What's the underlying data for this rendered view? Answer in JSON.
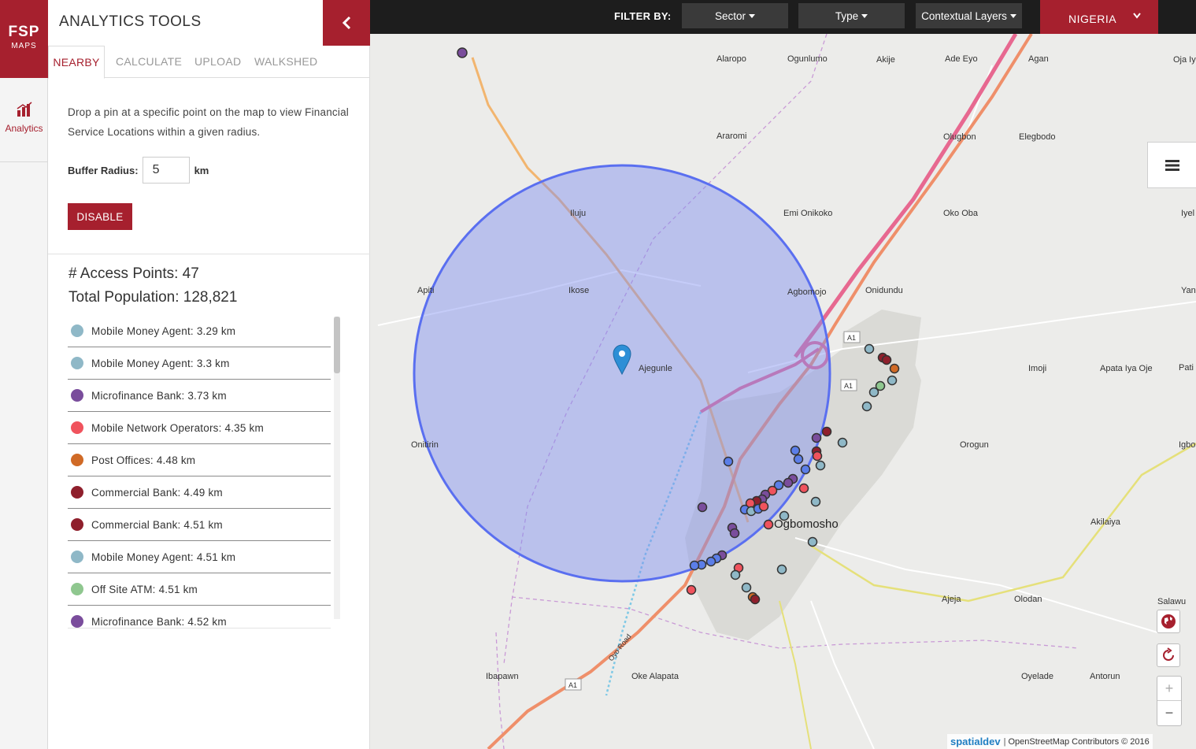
{
  "app": {
    "logo_line1": "FSP",
    "logo_line2": "MAPS",
    "rail_analytics_label": "Analytics",
    "brand_color": "#a6202e"
  },
  "panel": {
    "title": "ANALYTICS TOOLS",
    "collapse_icon": "chevron-left-icon",
    "tabs": [
      {
        "label": "NEARBY",
        "active": true
      },
      {
        "label": "CALCULATE",
        "active": false
      },
      {
        "label": "UPLOAD",
        "active": false
      },
      {
        "label": "WALKSHED",
        "active": false
      }
    ],
    "description": "Drop a pin at a specific point on the map to view Financial Service Locations within a given radius.",
    "buffer_label": "Buffer Radius:",
    "buffer_value": "5",
    "buffer_unit": "km",
    "disable_label": "DISABLE",
    "access_points": "# Access Points: 47",
    "total_population": "Total Population: 128,821",
    "results": [
      {
        "label": "Mobile Money Agent: 3.29 km",
        "color": "#8fb8c7"
      },
      {
        "label": "Mobile Money Agent: 3.3 km",
        "color": "#8fb8c7"
      },
      {
        "label": "Microfinance Bank: 3.73 km",
        "color": "#7a4d9c"
      },
      {
        "label": "Mobile Network Operators: 4.35 km",
        "color": "#f0535d"
      },
      {
        "label": "Post Offices: 4.48 km",
        "color": "#d06a26"
      },
      {
        "label": "Commercial Bank: 4.49 km",
        "color": "#8f1f2c"
      },
      {
        "label": "Commercial Bank: 4.51 km",
        "color": "#8f1f2c"
      },
      {
        "label": "Mobile Money Agent: 4.51 km",
        "color": "#8fb8c7"
      },
      {
        "label": "Off Site ATM: 4.51 km",
        "color": "#8fc78f"
      },
      {
        "label": "Microfinance Bank: 4.52 km",
        "color": "#7a4d9c"
      }
    ]
  },
  "topbar": {
    "filter_label": "FILTER BY:",
    "sector": "Sector",
    "type": "Type",
    "contextual_layers": "Contextual Layers",
    "country": "NIGERIA"
  },
  "map": {
    "places": [
      "Alaropo",
      "Ogunlumo",
      "Akije",
      "Ade Eyo",
      "Agan",
      "Oja Iy",
      "Araromi",
      "Olugbon",
      "Elegbodo",
      "Iluju",
      "Emi Onikoko",
      "Oko Oba",
      "Iyel",
      "Apiti",
      "Ikose",
      "Agbomojo",
      "Onidundu",
      "Yan",
      "Ajegunle",
      "Imoji",
      "Apata Iya Oje",
      "Pati",
      "Onitirin",
      "Orogun",
      "Igbo",
      "Akilaiya",
      "Ajeja",
      "Olodan",
      "Salawu",
      "Ibapawn",
      "Oke Alapata",
      "Oyelade",
      "Antorun"
    ],
    "city": "Ogbomosho",
    "road_shield": "A1",
    "road_name": "Oyo Road",
    "buffer_fill": "#7f8ff0",
    "attribution_brand": "spatialdev",
    "attribution_text": "OpenStreetMap Contributors © 2016"
  }
}
